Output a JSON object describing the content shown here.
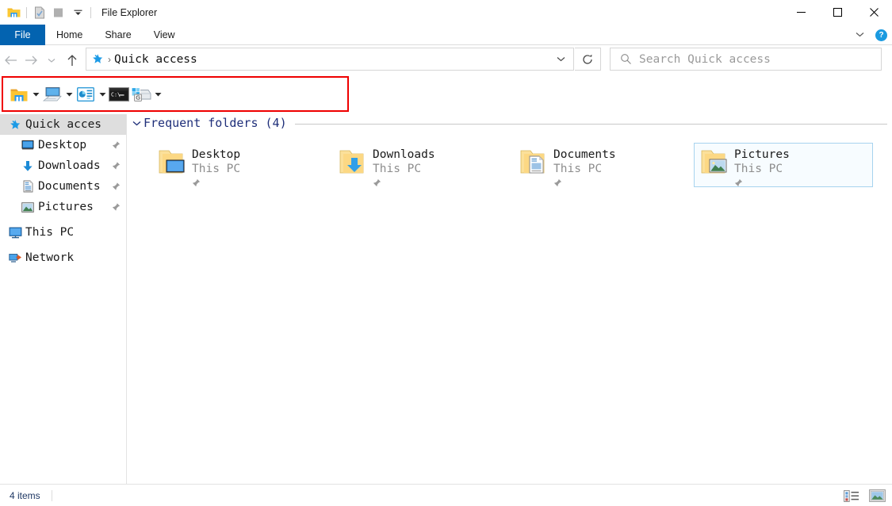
{
  "window": {
    "title": "File Explorer",
    "quick_access_toolbar": [
      {
        "name": "explorer-icon",
        "label": "File Explorer"
      },
      {
        "name": "properties-icon",
        "label": "Properties"
      },
      {
        "name": "new-folder-icon",
        "label": "New folder"
      },
      {
        "name": "customize-caret",
        "label": "Customize Quick Access Toolbar"
      }
    ],
    "controls": {
      "minimize": "Minimize",
      "maximize": "Maximize",
      "close": "Close"
    }
  },
  "ribbon": {
    "tabs": [
      {
        "label": "File",
        "active": true
      },
      {
        "label": "Home",
        "active": false
      },
      {
        "label": "Share",
        "active": false
      },
      {
        "label": "View",
        "active": false
      }
    ],
    "collapse_label": "Minimize the Ribbon",
    "help_label": "?"
  },
  "navigation": {
    "back_label": "Back",
    "forward_label": "Forward",
    "recent_label": "Recent locations",
    "up_label": "Up",
    "refresh_label": "Refresh"
  },
  "address": {
    "icon": "quick-access-star-icon",
    "separator": "›",
    "path": "Quick access",
    "dropdown_label": "Previous locations"
  },
  "search": {
    "placeholder": "Search Quick access",
    "icon": "search-icon"
  },
  "toolbar": {
    "highlight_color": "#ef0000",
    "items": [
      {
        "name": "folder-toolbar-icon",
        "label": "Folder",
        "has_caret": true
      },
      {
        "name": "computer-toolbar-icon",
        "label": "This PC",
        "has_caret": true
      },
      {
        "name": "control-panel-toolbar-icon",
        "label": "Control Panel",
        "has_caret": true
      },
      {
        "name": "command-prompt-toolbar-icon",
        "label": "Command Prompt",
        "has_caret": false
      },
      {
        "name": "drive-g-toolbar-icon",
        "label": "Drive G",
        "has_caret": true
      }
    ]
  },
  "sidebar": {
    "items": [
      {
        "label": "Quick acces",
        "icon": "star-icon",
        "level": "root",
        "selected": true,
        "pinned": false
      },
      {
        "label": "Desktop",
        "icon": "desktop-icon",
        "level": "child",
        "selected": false,
        "pinned": true
      },
      {
        "label": "Downloads",
        "icon": "downloads-icon",
        "level": "child",
        "selected": false,
        "pinned": true
      },
      {
        "label": "Documents",
        "icon": "documents-icon",
        "level": "child",
        "selected": false,
        "pinned": true
      },
      {
        "label": "Pictures",
        "icon": "pictures-icon",
        "level": "child",
        "selected": false,
        "pinned": true
      },
      {
        "label": "This PC",
        "icon": "thispc-icon",
        "level": "root",
        "selected": false,
        "pinned": false
      },
      {
        "label": "Network",
        "icon": "network-icon",
        "level": "root",
        "selected": false,
        "pinned": false
      }
    ]
  },
  "content": {
    "group": {
      "title": "Frequent folders (4)",
      "expanded": true,
      "title_color": "#1f2f7a"
    },
    "tiles": [
      {
        "name": "Desktop",
        "location": "This PC",
        "icon": "folder-desktop-icon",
        "pinned": true,
        "selected": false
      },
      {
        "name": "Downloads",
        "location": "This PC",
        "icon": "folder-downloads-icon",
        "pinned": true,
        "selected": false
      },
      {
        "name": "Documents",
        "location": "This PC",
        "icon": "folder-documents-icon",
        "pinned": true,
        "selected": false
      },
      {
        "name": "Pictures",
        "location": "This PC",
        "icon": "folder-pictures-icon",
        "pinned": true,
        "selected": true
      }
    ]
  },
  "status": {
    "item_count": "4 items",
    "views": [
      {
        "name": "details-view-button",
        "label": "Details view"
      },
      {
        "name": "large-icons-view-button",
        "label": "Large icons view"
      }
    ]
  }
}
